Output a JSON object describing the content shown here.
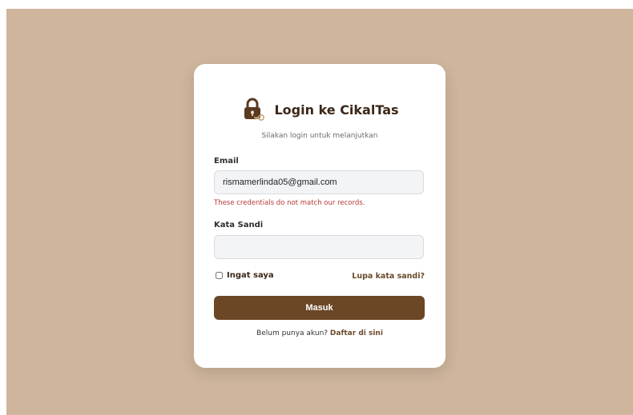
{
  "colors": {
    "backdrop": "#ceb59c",
    "card": "#ffffff",
    "accent": "#6b4726",
    "error": "#b83a3a"
  },
  "header": {
    "icon": "lock-key-icon",
    "title": "Login ke CikalTas",
    "subtitle": "Silakan login untuk melanjutkan"
  },
  "form": {
    "email": {
      "label": "Email",
      "value": "rismamerlinda05@gmail.com",
      "error": "These credentials do not match our records."
    },
    "password": {
      "label": "Kata Sandi",
      "value": ""
    },
    "remember_label": "Ingat saya",
    "remember_checked": false,
    "forgot_label": "Lupa kata sandi?",
    "submit_label": "Masuk"
  },
  "footer": {
    "prompt": "Belum punya akun?",
    "register_link": "Daftar di sini"
  }
}
